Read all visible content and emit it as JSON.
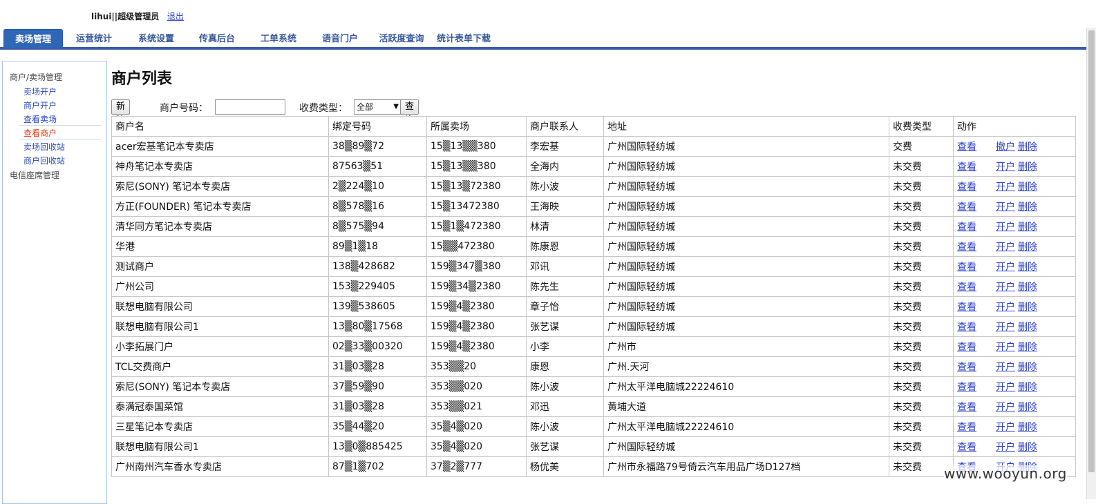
{
  "header": {
    "username": "lihui||超级管理员",
    "logout_label": "退出"
  },
  "nav": {
    "tabs": [
      {
        "label": "卖场管理",
        "active": true
      },
      {
        "label": "运营统计"
      },
      {
        "label": "系统设置"
      },
      {
        "label": "传真后台"
      },
      {
        "label": "工单系统"
      },
      {
        "label": "语音门户"
      },
      {
        "label": "活跃度查询"
      },
      {
        "label": "统计表单下载"
      }
    ]
  },
  "sidebar": {
    "section1": "商户/卖场管理",
    "items": [
      {
        "label": "卖场开户"
      },
      {
        "label": "商户开户"
      },
      {
        "label": "查看卖场"
      },
      {
        "label": "查看商户",
        "current": true
      },
      {
        "label": "卖场回收站"
      },
      {
        "label": "商户回收站"
      }
    ],
    "section2": "电信座席管理"
  },
  "main": {
    "title": "商户列表",
    "toolbar": {
      "new_label": "新建",
      "merchant_no_label": "商户号码：",
      "merchant_no_value": "",
      "fee_type_label": "收费类型：",
      "fee_type_value": "全部",
      "query_label": "查询"
    },
    "table": {
      "columns": [
        "商户名",
        "绑定号码",
        "所属卖场",
        "商户联系人",
        "地址",
        "收费类型",
        "动作"
      ],
      "rows": [
        {
          "name": "acer宏基笔记本专卖店",
          "phone": "38▒89▒72",
          "mall": "15▒13▒▒380",
          "contact": "李宏基",
          "address": "广州国际轻纺城",
          "fee": "交费",
          "view": "查看",
          "toggle": "撤户",
          "del": "删除"
        },
        {
          "name": "神舟笔记本专卖店",
          "phone": "87563▒51",
          "mall": "15▒13▒▒380",
          "contact": "全海内",
          "address": "广州国际轻纺城",
          "fee": "未交费",
          "view": "查看",
          "toggle": "开户",
          "del": "删除"
        },
        {
          "name": "索尼(SONY) 笔记本专卖店",
          "phone": "2▒224▒10",
          "mall": "15▒13▒72380",
          "contact": "陈小波",
          "address": "广州国际轻纺城",
          "fee": "未交费",
          "view": "查看",
          "toggle": "开户",
          "del": "删除"
        },
        {
          "name": "方正(FOUNDER) 笔记本专卖店",
          "phone": "8▒578▒16",
          "mall": "15▒13472380",
          "contact": "王海映",
          "address": "广州国际轻纺城",
          "fee": "未交费",
          "view": "查看",
          "toggle": "开户",
          "del": "删除"
        },
        {
          "name": "清华同方笔记本专卖店",
          "phone": "8▒575▒94",
          "mall": "15▒1▒472380",
          "contact": "林清",
          "address": "广州国际轻纺城",
          "fee": "未交费",
          "view": "查看",
          "toggle": "开户",
          "del": "删除"
        },
        {
          "name": "华港",
          "phone": "89▒1▒18",
          "mall": "15▒▒472380",
          "contact": "陈康恩",
          "address": "广州国际轻纺城",
          "fee": "未交费",
          "view": "查看",
          "toggle": "开户",
          "del": "删除"
        },
        {
          "name": "测试商户",
          "phone": "138▒428682",
          "mall": "159▒347▒380",
          "contact": "邓讯",
          "address": "广州国际轻纺城",
          "fee": "未交费",
          "view": "查看",
          "toggle": "开户",
          "del": "删除"
        },
        {
          "name": "广州公司",
          "phone": "153▒229405",
          "mall": "159▒34▒2380",
          "contact": "陈先生",
          "address": "广州国际轻纺城",
          "fee": "未交费",
          "view": "查看",
          "toggle": "开户",
          "del": "删除"
        },
        {
          "name": "联想电脑有限公司",
          "phone": "139▒538605",
          "mall": "159▒4▒2380",
          "contact": "章子怡",
          "address": "广州国际轻纺城",
          "fee": "未交费",
          "view": "查看",
          "toggle": "开户",
          "del": "删除"
        },
        {
          "name": "联想电脑有限公司1",
          "phone": "13▒80▒17568",
          "mall": "159▒4▒2380",
          "contact": "张艺谋",
          "address": "广州国际轻纺城",
          "fee": "未交费",
          "view": "查看",
          "toggle": "开户",
          "del": "删除"
        },
        {
          "name": "小李拓展门户",
          "phone": "02▒33▒00320",
          "mall": "159▒4▒2380",
          "contact": "小李",
          "address": "广州市",
          "fee": "未交费",
          "view": "查看",
          "toggle": "开户",
          "del": "删除"
        },
        {
          "name": "TCL交费商户",
          "phone": "31▒03▒28",
          "mall": "353▒▒20",
          "contact": "康恩",
          "address": "广州.天河",
          "fee": "未交费",
          "view": "查看",
          "toggle": "开户",
          "del": "删除"
        },
        {
          "name": "索尼(SONY) 笔记本专卖店",
          "phone": "37▒59▒90",
          "mall": "353▒▒020",
          "contact": "陈小波",
          "address": "广州太平洋电脑城22224610",
          "fee": "未交费",
          "view": "查看",
          "toggle": "开户",
          "del": "删除"
        },
        {
          "name": "泰满冠泰国菜馆",
          "phone": "31▒03▒28",
          "mall": "353▒▒021",
          "contact": "邓迅",
          "address": "黄埔大道",
          "fee": "未交费",
          "view": "查看",
          "toggle": "开户",
          "del": "删除"
        },
        {
          "name": "三星笔记本专卖店",
          "phone": "35▒44▒20",
          "mall": "35▒4▒020",
          "contact": "陈小波",
          "address": "广州太平洋电脑城22224610",
          "fee": "未交费",
          "view": "查看",
          "toggle": "开户",
          "del": "删除"
        },
        {
          "name": "联想电脑有限公司1",
          "phone": "13▒0▒885425",
          "mall": "35▒4▒020",
          "contact": "张艺谋",
          "address": "广州国际轻纺城",
          "fee": "未交费",
          "view": "查看",
          "toggle": "开户",
          "del": "删除"
        },
        {
          "name": "广州南州汽车香水专卖店",
          "phone": "87▒1▒702",
          "mall": "37▒2▒777",
          "contact": "杨优美",
          "address": "广州市永福路79号倚云汽车用品广场D127档",
          "fee": "未交费",
          "view": "查看",
          "toggle": "开户",
          "del": "删除"
        }
      ]
    }
  },
  "watermark": "www.wooyun.org"
}
